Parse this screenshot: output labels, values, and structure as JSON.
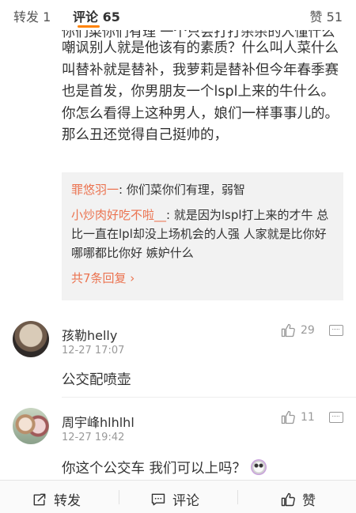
{
  "tabs": {
    "repost": "转发 1",
    "comment": "评论 65",
    "like": "赞 51"
  },
  "partial_text": "你们菜你们有理 一个只会打打杀杀的人懂什么",
  "main_comment": {
    "text": "嘲讽别人就是他该有的素质？什么叫人菜什么叫替补就是替补，我萝莉是替补但今年春季赛也是首发，你男朋友一个lspl上来的牛什么。你怎么看得上这种男人，娘们一样事事儿的。那么丑还觉得自己挺帅的，"
  },
  "replies": [
    {
      "name": "罪悠羽一",
      "sep": ": ",
      "text": "你们菜你们有理，弱智"
    },
    {
      "name": "小炒肉好吃不啦__",
      "sep": ": ",
      "text": "就是因为lspl打上来的才牛 总比一直在lpl却没上场机会的人强 人家就是比你好 哪哪都比你好 嫉妒什么"
    }
  ],
  "more_replies": "共7条回复 ›",
  "comments": [
    {
      "name": "孩勒helly",
      "time": "12-27 17:07",
      "text": "公交配喷壶",
      "likes": "29"
    },
    {
      "name": "周宇峰hlhlhl",
      "time": "12-27 19:42",
      "text": "你这个公交车 我们可以上吗？",
      "likes": "11"
    }
  ],
  "bottom": {
    "repost": "转发",
    "comment": "评论",
    "like": "赞"
  },
  "icons": [
    "thumbs-up-icon",
    "more-icon",
    "repost-icon",
    "comment-icon",
    "emoji-icon"
  ],
  "colors": {
    "accent": "#ff8200",
    "link": "#eb7350"
  }
}
